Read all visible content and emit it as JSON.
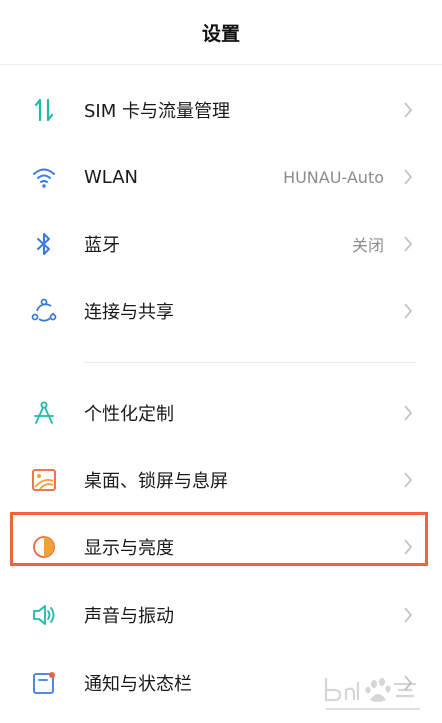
{
  "header": {
    "title": "设置"
  },
  "items": [
    {
      "label": "SIM 卡与流量管理",
      "value": "",
      "icon": "sim-data-arrows-icon"
    },
    {
      "label": "WLAN",
      "value": "HUNAU-Auto",
      "icon": "wifi-icon"
    },
    {
      "label": "蓝牙",
      "value": "关闭",
      "icon": "bluetooth-icon"
    },
    {
      "label": "连接与共享",
      "value": "",
      "icon": "connection-share-icon"
    },
    {
      "label": "个性化定制",
      "value": "",
      "icon": "compass-icon"
    },
    {
      "label": "桌面、锁屏与息屏",
      "value": "",
      "icon": "wallpaper-icon"
    },
    {
      "label": "显示与亮度",
      "value": "",
      "icon": "brightness-icon"
    },
    {
      "label": "声音与振动",
      "value": "",
      "icon": "speaker-icon"
    },
    {
      "label": "通知与状态栏",
      "value": "",
      "icon": "notification-icon"
    }
  ],
  "colors": {
    "accent_teal": "#1fb9a8",
    "accent_blue": "#3a7be0",
    "accent_orange": "#f0643a",
    "accent_amber": "#f3a03b"
  }
}
